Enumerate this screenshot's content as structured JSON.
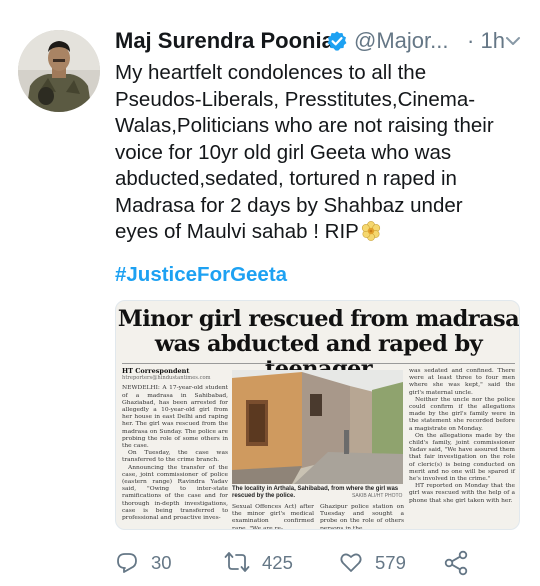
{
  "tweet": {
    "author_name": "Maj Surendra Poonia",
    "handle": "@Major...",
    "time_separator": "·",
    "time": "1h",
    "text_lines": [
      "My heartfelt condolences to all the",
      "Pseudos-Liberals, Presstitutes,Cinema-",
      "Walas,Politicians who are not raising their",
      "voice for 10yr old girl Geeta who was",
      "abducted,sedated, tortured n raped in",
      "Madrasa for 2 days by Shahbaz under",
      "eyes of Maulvi sahab ! RIP"
    ],
    "hashtag": "#JusticeForGeeta"
  },
  "news_clipping": {
    "headline_line1": "Minor girl rescued from madrasa",
    "headline_line2": "was abducted and raped by teenager",
    "byline": "HT Correspondent",
    "byline_email": "htreporters@hindustantimes.com",
    "col1": [
      "NEWDELHI: A 17-year-old student of a madrasa in Sahibabad, Ghaziabad, has been arrested for allegedly a 10-year-old girl from her house in east Delhi and raping her. The girl was rescued from the madrasa on Sunday. The police are probing the role of some others in the case.",
      "On Tuesday, the case was transferred to the crime branch.",
      "Announcing the transfer of the case, joint commissioner of police (eastern range) Ravindra Yadav said, \"Owing to inter-state ramifications of the case and for thorough in-depth investigations, case is being transferred to professional and proactive inves-"
    ],
    "col_right": [
      "was sedated and confined. There were at least three to four men where she was kept,\" said the girl's maternal uncle.",
      "Neither the uncle nor the police could confirm if the allegations made by the girl's family were in the statement she recorded before a magistrate on Monday.",
      "On the allegations made by the child's family, joint commissioner Yadav said, \"We have assured them that fair investigation on the role of cleric(s) is being conducted on merit and no one will be spared if he's involved in the crime.\"",
      "HT reported on Monday that the girl was rescued with the help of a phone that she girl taken with her."
    ],
    "photo_caption": "The locality in Arthala, Sahibabad, from where the girl was rescued by the police.",
    "photo_credit": "SAKIB ALI/HT PHOTO",
    "col_bottom_mid": "Sexual Offences Act) after the minor girl's medical examination confirmed rape. \"We are re-",
    "col_bottom_right": "Ghazipur police station on Tuesday and sought a probe on the role of others persons in the"
  },
  "actions": {
    "replies": "30",
    "retweets": "425",
    "likes": "579"
  },
  "icons": [
    "verified-badge-icon",
    "chevron-down-icon",
    "flower-emoji-icon",
    "reply-icon",
    "retweet-icon",
    "like-icon",
    "share-icon"
  ],
  "colors": {
    "link": "#1da1f2",
    "secondary_text": "#657786",
    "primary_text": "#14171a",
    "verified": "#1da1f2"
  }
}
